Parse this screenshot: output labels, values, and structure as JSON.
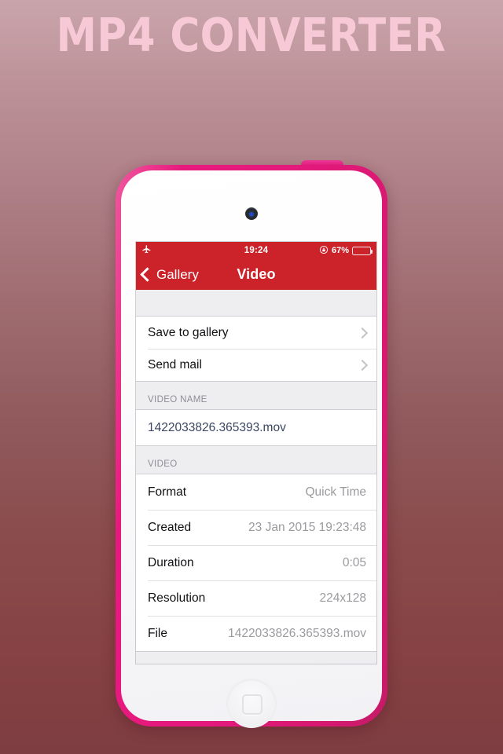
{
  "banner": {
    "title": "MP4 CONVERTER",
    "color": "#f7c9d6"
  },
  "device": {
    "bezel_color": "#e8197e",
    "body_color": "#ffffff",
    "camera_icon": "front-camera",
    "home_button_icon": "rounded-square"
  },
  "statusbar": {
    "airplane_icon": "airplane-mode-icon",
    "time": "19:24",
    "rotation_lock_icon": "rotation-lock-icon",
    "battery_percent": "67%",
    "battery_level": 62
  },
  "navbar": {
    "back_label": "Gallery",
    "back_icon": "chevron-left-icon",
    "title": "Video",
    "bar_color": "#cc2229"
  },
  "actions": {
    "items": [
      {
        "label": "Save to gallery",
        "accessory": "chevron-right-icon"
      },
      {
        "label": "Send mail",
        "accessory": "chevron-right-icon"
      }
    ]
  },
  "video_name": {
    "header": "VIDEO NAME",
    "value": "1422033826.365393.mov",
    "value_color": "#3b4663"
  },
  "video_info": {
    "header": "VIDEO",
    "rows": [
      {
        "label": "Format",
        "value": "Quick Time"
      },
      {
        "label": "Created",
        "value": "23 Jan 2015 19:23:48"
      },
      {
        "label": "Duration",
        "value": "0:05"
      },
      {
        "label": "Resolution",
        "value": "224x128"
      },
      {
        "label": "File",
        "value": "1422033826.365393.mov"
      }
    ]
  }
}
